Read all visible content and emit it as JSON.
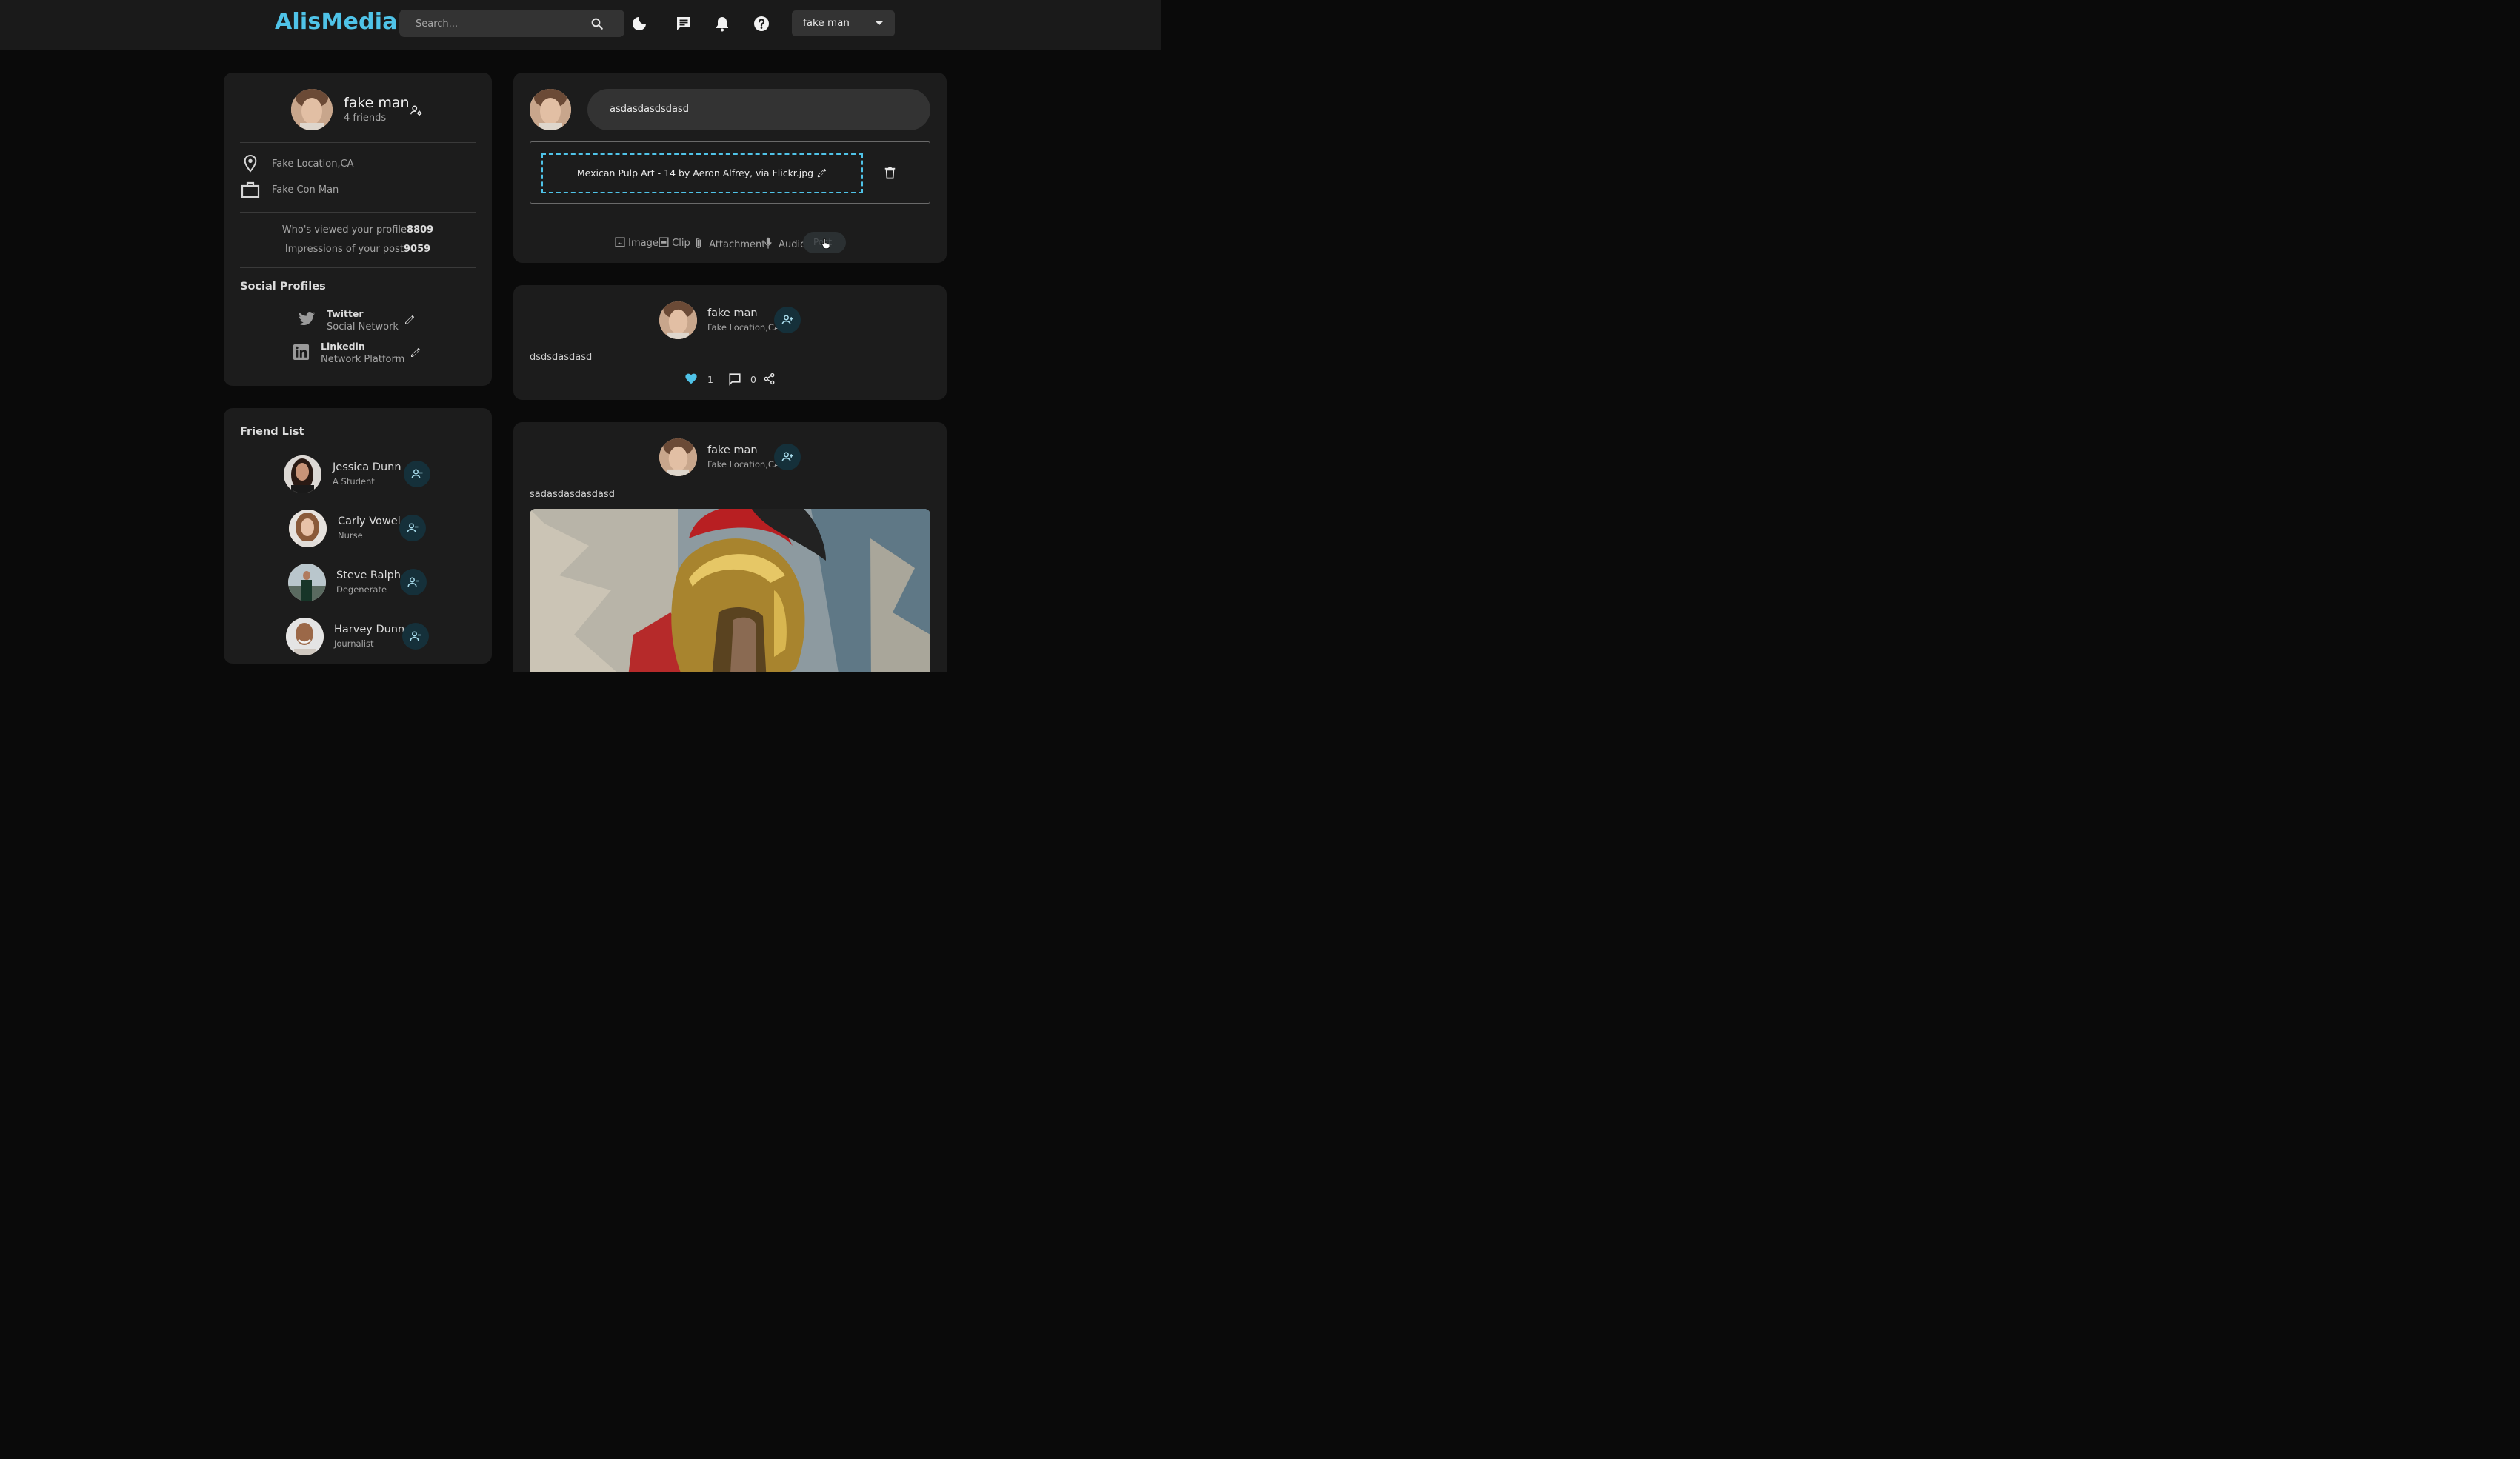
{
  "app": {
    "logo": "AlisMedia",
    "search": {
      "placeholder": "Search..."
    },
    "user_menu": {
      "selected": "fake man"
    }
  },
  "profile": {
    "name": "fake man",
    "friends": "4 friends",
    "location": "Fake Location,CA",
    "occupation": "Fake Con Man",
    "viewed_label": "Who's viewed your profile",
    "viewed_value": "8809",
    "impressions_label": "Impressions of your post",
    "impressions_value": "9059",
    "social_title": "Social Profiles",
    "social": [
      {
        "name": "Twitter",
        "desc": "Social Network",
        "icon": "twitter-icon"
      },
      {
        "name": "Linkedin",
        "desc": "Network Platform",
        "icon": "linkedin-icon"
      }
    ]
  },
  "friends": {
    "title": "Friend List",
    "items": [
      {
        "name": "Jessica Dunn",
        "role": "A Student"
      },
      {
        "name": "Carly Vowel",
        "role": "Nurse"
      },
      {
        "name": "Steve Ralph",
        "role": "Degenerate"
      },
      {
        "name": "Harvey Dunn",
        "role": "Journalist"
      }
    ]
  },
  "composer": {
    "input_value": "asdasdasdsdasd",
    "file_name": "Mexican Pulp Art - 14 by Aeron Alfrey, via Flickr.jpg",
    "actions": {
      "image": "Image",
      "clip": "Clip",
      "attachment": "Attachment",
      "audio": "Audio",
      "post": "Post"
    }
  },
  "posts": [
    {
      "author": "fake man",
      "location": "Fake Location,CA",
      "text": "dsdsdasdasd",
      "likes": "1",
      "comments": "0"
    },
    {
      "author": "fake man",
      "location": "Fake Location,CA",
      "text": "sadasdasdasdasd"
    }
  ],
  "colors": {
    "accent": "#4fc3e8",
    "card": "#1c1c1c",
    "background": "#0a0a0a",
    "topbar": "#1a1a1a"
  }
}
